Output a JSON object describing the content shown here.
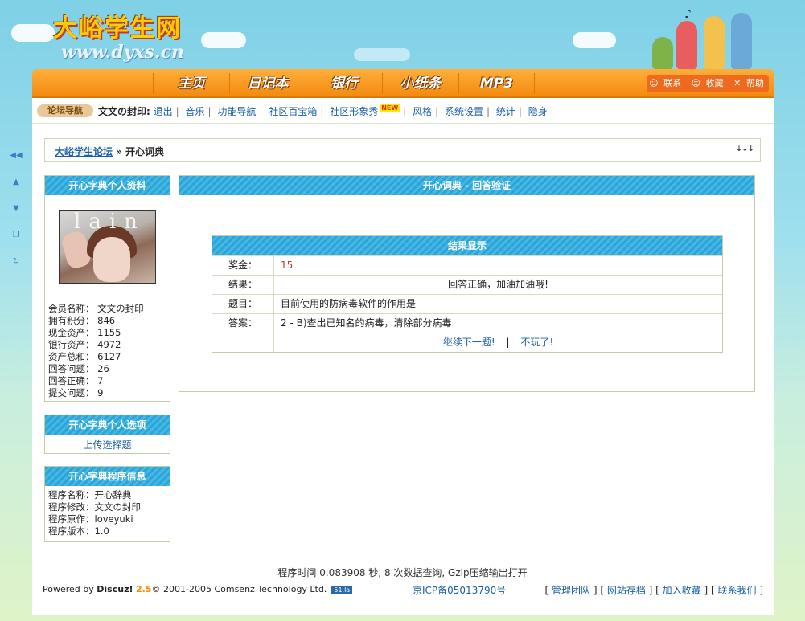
{
  "brand": {
    "title": "大峪学生网",
    "url": "www.dyxs.cn"
  },
  "nav": {
    "items": [
      "主页",
      "日记本",
      "银行",
      "小纸条",
      "MP3"
    ],
    "right": [
      "联系",
      "收藏",
      "帮助"
    ]
  },
  "subnav": {
    "tag": "论坛导航",
    "user": "文文の封印:",
    "links": [
      "退出",
      "音乐",
      "功能导航",
      "社区百宝箱",
      "社区形象秀",
      "风格",
      "系统设置",
      "统计",
      "隐身"
    ],
    "new_badge": "NEW"
  },
  "breadcrumb": {
    "home": "大峪学生论坛",
    "sep": "»",
    "current": "开心词典",
    "arrows": "↓↓↓"
  },
  "profile": {
    "title": "开心字典个人资料",
    "avatar_text": "lain",
    "stats": [
      "会员名称： 文文の封印",
      "拥有积分： 846",
      "现金资产： 1155",
      "银行资产： 4972",
      "资产总和： 6127",
      "回答问题： 26",
      "回答正确： 7",
      "提交问题： 9"
    ]
  },
  "options": {
    "title": "开心字典个人选项",
    "link": "上传选择题"
  },
  "proginfo": {
    "title": "开心字典程序信息",
    "lines": [
      "程序名称：开心辞典",
      "程序修改：文文の封印",
      "程序原作：loveyuki",
      "程序版本：1.0"
    ]
  },
  "content": {
    "title": "开心词典 - 回答验证",
    "result_title": "结果显示",
    "rows": [
      {
        "key": "奖金：",
        "value": "15"
      },
      {
        "key": "结果：",
        "value": "回答正确，加油加油哦!"
      },
      {
        "key": "题目：",
        "value": "目前使用的防病毒软件的作用是"
      },
      {
        "key": "答案：",
        "value": "2 - B)查出已知名的病毒，清除部分病毒"
      }
    ],
    "next_link": "继续下一题!",
    "sep": "|",
    "quit_link": "不玩了!"
  },
  "footer": {
    "time": "程序时间 0.083908 秒, 8 次数据查询, Gzip压缩输出打开",
    "powered_prefix": "Powered by ",
    "powered_brand": "Discuz!",
    "powered_version": "2.5",
    "copyright": "© 2001-2005 Comsenz Technology Ltd.",
    "counter": "51.la",
    "icp": "京ICP备05013790号",
    "links": [
      "管理团队",
      "网站存档",
      "加入收藏",
      "联系我们"
    ]
  }
}
